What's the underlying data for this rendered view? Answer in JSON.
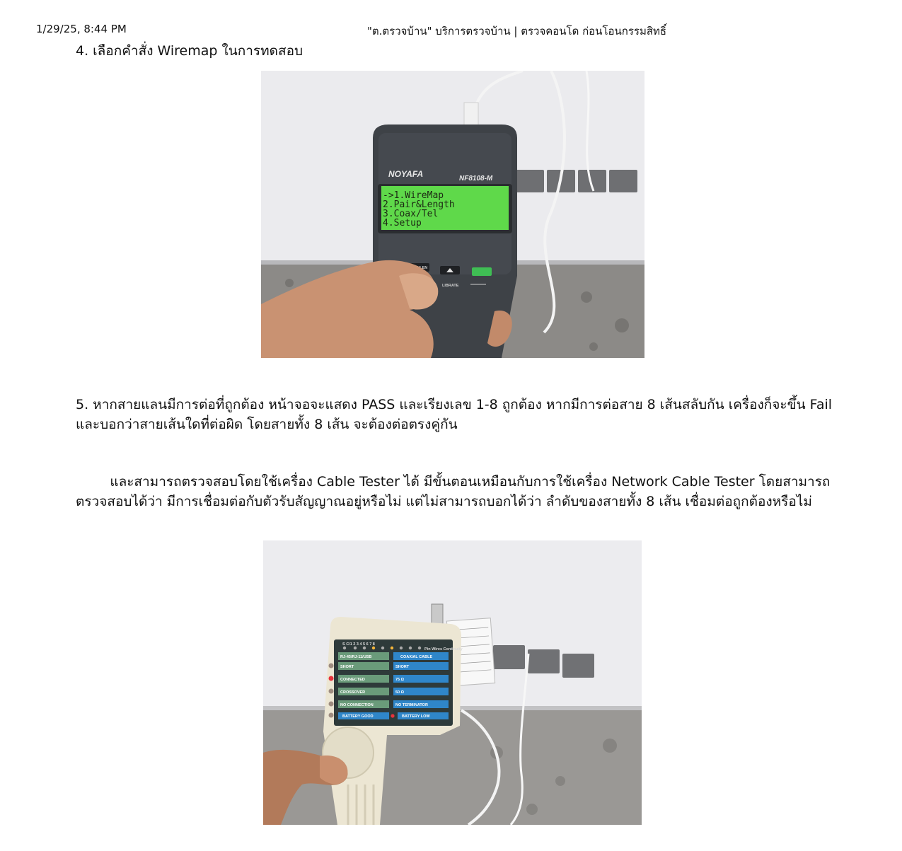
{
  "header": {
    "datetime": "1/29/25, 8:44 PM",
    "title": "\"ต.ตรวจบ้าน\" บริการตรวจบ้าน | ตรวจคอนโด ก่อนโอนกรรมสิทธิ์"
  },
  "content": {
    "step4": "4. เลือกคำสั่ง Wiremap ในการทดสอบ",
    "step5": "5. หากสายแลนมีการต่อที่ถูกต้อง หน้าจอจะแสดง PASS และเรียงเลข 1-8 ถูกต้อง หากมีการต่อสาย 8 เส้นสลับกัน เครื่องก็จะขึ้น Fail และบอกว่าสายเส้นใดที่ต่อผิด โดยสายทั้ง 8 เส้น จะต้องต่อตรงคู่กัน",
    "cable_tester_para": "        และสามารถตรวจสอบโดยใช้เครื่อง Cable Tester ได้ มีขั้นตอนเหมือนกับการใช้เครื่อง Network Cable Tester โดยสามารถตรวจสอบได้ว่า มีการเชื่อมต่อกับตัวรับสัญญาณอยู่หรือไม่ แต่ไม่สามารถบอกได้ว่า ลำดับของสายทั้ง 8 เส้น เชื่อมต่อถูกต้องหรือไม่"
  },
  "photo1": {
    "brand": "NOYAFA",
    "model": "NF8108-M",
    "menu": [
      "->1.WireMap",
      "  2.Pair&Length",
      "  3.Coax/Tel",
      "  4.Setup"
    ],
    "key_label": "PAIR/LEN",
    "calibrate_label": "LIBRATE"
  },
  "photo2": {
    "panel_left_title": "RJ-45/RJ-11/USB",
    "panel_right_title": "COAXIAL CABLE",
    "left_rows": [
      "SHORT",
      "CONNECTED",
      "CROSSOVER",
      "NO CONNECTION"
    ],
    "right_rows": [
      "SHORT",
      "75 Ω",
      "50 Ω",
      "NO TERMINATOR"
    ],
    "battery_good": "BATTERY GOOD",
    "battery_low": "BATTERY LOW",
    "pin_label": "S C/1 2 3 4 5 6 7 8",
    "corner_label": "Pin Wires Continuity"
  },
  "colors": {
    "lcd_green": "#5fd94a",
    "device_dark": "#3e4247",
    "panel_blue": "#2f86c9",
    "panel_green": "#6a9b7a"
  }
}
